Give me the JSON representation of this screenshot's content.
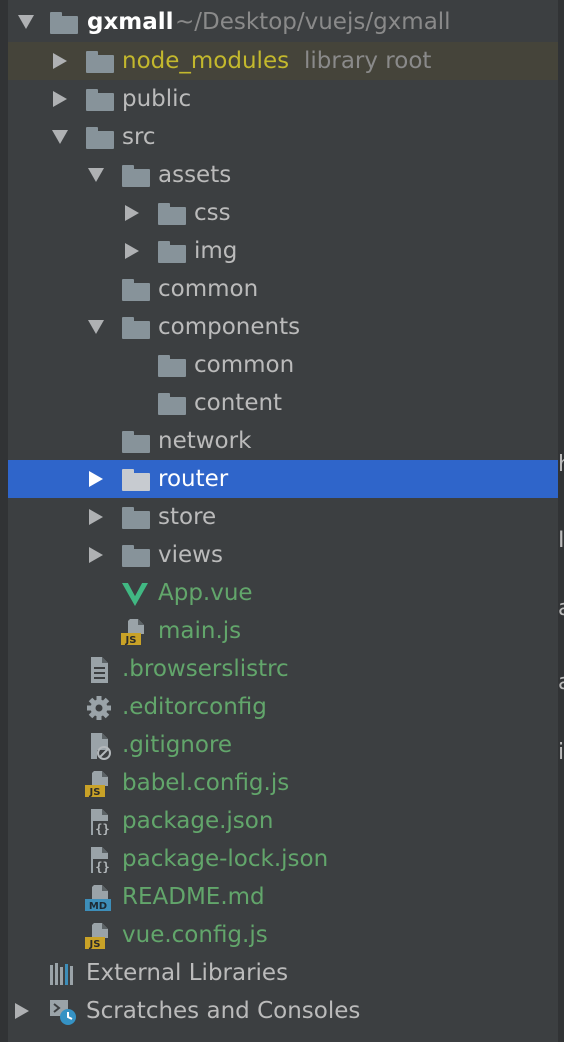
{
  "project": {
    "name": "gxmall",
    "path": "~/Desktop/vuejs/gxmall"
  },
  "items": {
    "node_modules": {
      "name": "node_modules",
      "note": "library root"
    },
    "public": {
      "name": "public"
    },
    "src": {
      "name": "src"
    },
    "assets": {
      "name": "assets"
    },
    "css": {
      "name": "css"
    },
    "img": {
      "name": "img"
    },
    "common": {
      "name": "common"
    },
    "components": {
      "name": "components"
    },
    "components_common": {
      "name": "common"
    },
    "components_content": {
      "name": "content"
    },
    "network": {
      "name": "network"
    },
    "router": {
      "name": "router"
    },
    "store": {
      "name": "store"
    },
    "views": {
      "name": "views"
    },
    "app_vue": {
      "name": "App.vue"
    },
    "main_js": {
      "name": "main.js"
    },
    "browserslistrc": {
      "name": ".browserslistrc"
    },
    "editorconfig": {
      "name": ".editorconfig"
    },
    "gitignore": {
      "name": ".gitignore"
    },
    "babel_config": {
      "name": "babel.config.js"
    },
    "package_json": {
      "name": "package.json"
    },
    "package_lock": {
      "name": "package-lock.json"
    },
    "readme": {
      "name": "README.md"
    },
    "vue_config": {
      "name": "vue.config.js"
    }
  },
  "external_libraries": "External Libraries",
  "scratches": "Scratches and Consoles",
  "badges": {
    "js": "JS",
    "md": "MD"
  },
  "colors": {
    "background": "#3c3f41",
    "selection": "#2f65ca",
    "excluded_row": "#45443a",
    "folder": "#87939a",
    "text": "#bbbbbb",
    "modified_green": "#62a66b",
    "excluded_yellow": "#c3b82d",
    "vue_green": "#41b883",
    "js_badge": "#c9a227",
    "md_badge": "#3d8eb9"
  },
  "edge_glyphs": [
    "h",
    "I",
    "a",
    "a",
    "i"
  ]
}
